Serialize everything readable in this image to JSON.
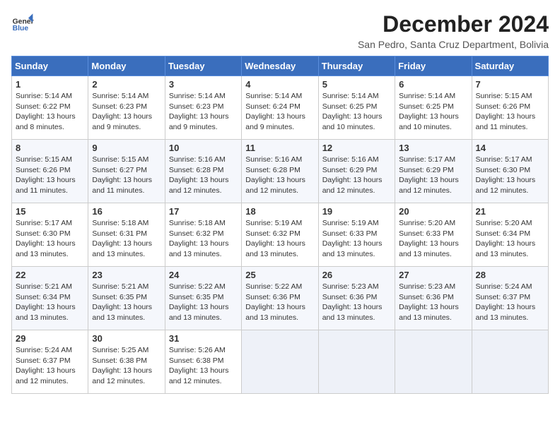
{
  "header": {
    "logo_general": "General",
    "logo_blue": "Blue",
    "title": "December 2024",
    "subtitle": "San Pedro, Santa Cruz Department, Bolivia"
  },
  "days_of_week": [
    "Sunday",
    "Monday",
    "Tuesday",
    "Wednesday",
    "Thursday",
    "Friday",
    "Saturday"
  ],
  "weeks": [
    [
      {
        "day": "1",
        "sunrise": "Sunrise: 5:14 AM",
        "sunset": "Sunset: 6:22 PM",
        "daylight": "Daylight: 13 hours and 8 minutes."
      },
      {
        "day": "2",
        "sunrise": "Sunrise: 5:14 AM",
        "sunset": "Sunset: 6:23 PM",
        "daylight": "Daylight: 13 hours and 9 minutes."
      },
      {
        "day": "3",
        "sunrise": "Sunrise: 5:14 AM",
        "sunset": "Sunset: 6:23 PM",
        "daylight": "Daylight: 13 hours and 9 minutes."
      },
      {
        "day": "4",
        "sunrise": "Sunrise: 5:14 AM",
        "sunset": "Sunset: 6:24 PM",
        "daylight": "Daylight: 13 hours and 9 minutes."
      },
      {
        "day": "5",
        "sunrise": "Sunrise: 5:14 AM",
        "sunset": "Sunset: 6:25 PM",
        "daylight": "Daylight: 13 hours and 10 minutes."
      },
      {
        "day": "6",
        "sunrise": "Sunrise: 5:14 AM",
        "sunset": "Sunset: 6:25 PM",
        "daylight": "Daylight: 13 hours and 10 minutes."
      },
      {
        "day": "7",
        "sunrise": "Sunrise: 5:15 AM",
        "sunset": "Sunset: 6:26 PM",
        "daylight": "Daylight: 13 hours and 11 minutes."
      }
    ],
    [
      {
        "day": "8",
        "sunrise": "Sunrise: 5:15 AM",
        "sunset": "Sunset: 6:26 PM",
        "daylight": "Daylight: 13 hours and 11 minutes."
      },
      {
        "day": "9",
        "sunrise": "Sunrise: 5:15 AM",
        "sunset": "Sunset: 6:27 PM",
        "daylight": "Daylight: 13 hours and 11 minutes."
      },
      {
        "day": "10",
        "sunrise": "Sunrise: 5:16 AM",
        "sunset": "Sunset: 6:28 PM",
        "daylight": "Daylight: 13 hours and 12 minutes."
      },
      {
        "day": "11",
        "sunrise": "Sunrise: 5:16 AM",
        "sunset": "Sunset: 6:28 PM",
        "daylight": "Daylight: 13 hours and 12 minutes."
      },
      {
        "day": "12",
        "sunrise": "Sunrise: 5:16 AM",
        "sunset": "Sunset: 6:29 PM",
        "daylight": "Daylight: 13 hours and 12 minutes."
      },
      {
        "day": "13",
        "sunrise": "Sunrise: 5:17 AM",
        "sunset": "Sunset: 6:29 PM",
        "daylight": "Daylight: 13 hours and 12 minutes."
      },
      {
        "day": "14",
        "sunrise": "Sunrise: 5:17 AM",
        "sunset": "Sunset: 6:30 PM",
        "daylight": "Daylight: 13 hours and 12 minutes."
      }
    ],
    [
      {
        "day": "15",
        "sunrise": "Sunrise: 5:17 AM",
        "sunset": "Sunset: 6:30 PM",
        "daylight": "Daylight: 13 hours and 13 minutes."
      },
      {
        "day": "16",
        "sunrise": "Sunrise: 5:18 AM",
        "sunset": "Sunset: 6:31 PM",
        "daylight": "Daylight: 13 hours and 13 minutes."
      },
      {
        "day": "17",
        "sunrise": "Sunrise: 5:18 AM",
        "sunset": "Sunset: 6:32 PM",
        "daylight": "Daylight: 13 hours and 13 minutes."
      },
      {
        "day": "18",
        "sunrise": "Sunrise: 5:19 AM",
        "sunset": "Sunset: 6:32 PM",
        "daylight": "Daylight: 13 hours and 13 minutes."
      },
      {
        "day": "19",
        "sunrise": "Sunrise: 5:19 AM",
        "sunset": "Sunset: 6:33 PM",
        "daylight": "Daylight: 13 hours and 13 minutes."
      },
      {
        "day": "20",
        "sunrise": "Sunrise: 5:20 AM",
        "sunset": "Sunset: 6:33 PM",
        "daylight": "Daylight: 13 hours and 13 minutes."
      },
      {
        "day": "21",
        "sunrise": "Sunrise: 5:20 AM",
        "sunset": "Sunset: 6:34 PM",
        "daylight": "Daylight: 13 hours and 13 minutes."
      }
    ],
    [
      {
        "day": "22",
        "sunrise": "Sunrise: 5:21 AM",
        "sunset": "Sunset: 6:34 PM",
        "daylight": "Daylight: 13 hours and 13 minutes."
      },
      {
        "day": "23",
        "sunrise": "Sunrise: 5:21 AM",
        "sunset": "Sunset: 6:35 PM",
        "daylight": "Daylight: 13 hours and 13 minutes."
      },
      {
        "day": "24",
        "sunrise": "Sunrise: 5:22 AM",
        "sunset": "Sunset: 6:35 PM",
        "daylight": "Daylight: 13 hours and 13 minutes."
      },
      {
        "day": "25",
        "sunrise": "Sunrise: 5:22 AM",
        "sunset": "Sunset: 6:36 PM",
        "daylight": "Daylight: 13 hours and 13 minutes."
      },
      {
        "day": "26",
        "sunrise": "Sunrise: 5:23 AM",
        "sunset": "Sunset: 6:36 PM",
        "daylight": "Daylight: 13 hours and 13 minutes."
      },
      {
        "day": "27",
        "sunrise": "Sunrise: 5:23 AM",
        "sunset": "Sunset: 6:36 PM",
        "daylight": "Daylight: 13 hours and 13 minutes."
      },
      {
        "day": "28",
        "sunrise": "Sunrise: 5:24 AM",
        "sunset": "Sunset: 6:37 PM",
        "daylight": "Daylight: 13 hours and 13 minutes."
      }
    ],
    [
      {
        "day": "29",
        "sunrise": "Sunrise: 5:24 AM",
        "sunset": "Sunset: 6:37 PM",
        "daylight": "Daylight: 13 hours and 12 minutes."
      },
      {
        "day": "30",
        "sunrise": "Sunrise: 5:25 AM",
        "sunset": "Sunset: 6:38 PM",
        "daylight": "Daylight: 13 hours and 12 minutes."
      },
      {
        "day": "31",
        "sunrise": "Sunrise: 5:26 AM",
        "sunset": "Sunset: 6:38 PM",
        "daylight": "Daylight: 13 hours and 12 minutes."
      },
      null,
      null,
      null,
      null
    ]
  ]
}
